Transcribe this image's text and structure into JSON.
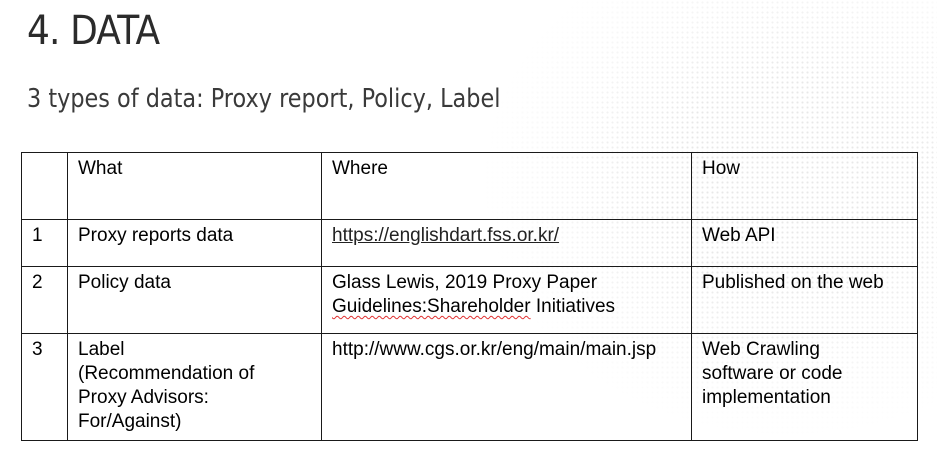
{
  "slide": {
    "title": "4. DATA",
    "subtitle": "3 types of data: Proxy report, Policy, Label"
  },
  "table": {
    "headers": {
      "num": "",
      "what": "What",
      "where": "Where",
      "how": "How"
    },
    "rows": [
      {
        "num": "1",
        "what": [
          "Proxy reports data"
        ],
        "where": [
          "https://englishdart.fss.or.kr/"
        ],
        "how": [
          "Web API"
        ]
      },
      {
        "num": "2",
        "what": [
          "Policy data"
        ],
        "where": [
          "Glass Lewis, 2019 Proxy Paper",
          "Guidelines:Shareholder",
          " Initiatives"
        ],
        "how": [
          "Published on the web"
        ]
      },
      {
        "num": "3",
        "what": [
          "Label",
          "(Recommendation of",
          "Proxy Advisors:",
          "For/Against)"
        ],
        "where": [
          "http://www.cgs.or.kr/eng/main/main.jsp"
        ],
        "how": [
          "Web Crawling",
          "software or code",
          "implementation"
        ]
      }
    ]
  }
}
